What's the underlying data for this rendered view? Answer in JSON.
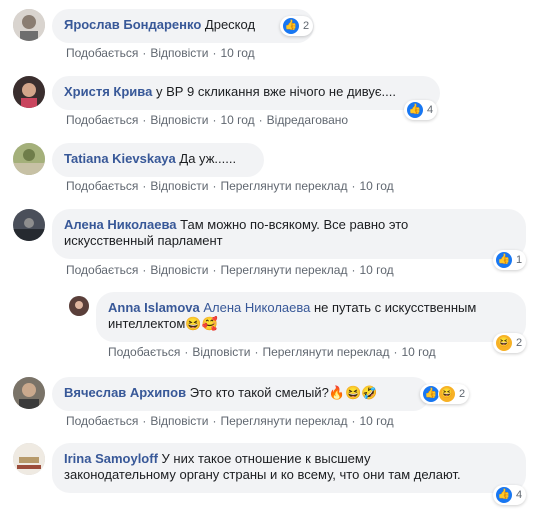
{
  "colors": {
    "author": "#385898",
    "bubble": "#f2f3f5",
    "meta": "#606770",
    "like": "#1877f2",
    "haha": "#f7b125"
  },
  "actions": {
    "like": "Подобається",
    "reply": "Відповісти",
    "translate": "Переглянути переклад",
    "edited": "Відредаговано"
  },
  "comments": [
    {
      "author": "Ярослав Бондаренко",
      "text": "Дрескод",
      "time": "10 год",
      "reactions": [
        "like-icon"
      ],
      "count": "2"
    },
    {
      "author": "Христя Крива",
      "text": "у ВР 9 скликання вже нічого не дивує....",
      "time": "10 год",
      "reactions": [
        "like-icon"
      ],
      "count": "4"
    },
    {
      "author": "Tatiana Kievskaya",
      "text": "Да уж......",
      "time": "10 год"
    },
    {
      "author": "Алена Николаева",
      "text_line1": "Там можно по-всякому. Все равно это",
      "text_line2": "искусственный парламент",
      "time": "10 год",
      "reactions": [
        "like-icon"
      ],
      "count": "1"
    },
    {
      "author": "Anna Islamova",
      "mention": "Алена Николаева",
      "text_line1": "не путать с искусственным",
      "text_line2": "интеллектом",
      "time": "10 год",
      "reactions": [
        "haha-icon"
      ],
      "count": "2"
    },
    {
      "author": "Вячеслав Архипов",
      "text": "Это кто такой смелый?",
      "time": "10 год",
      "reactions": [
        "like-icon",
        "haha-icon"
      ],
      "count": "2"
    },
    {
      "author": "Irina Samoyloff",
      "text_line1": "У них такое отношение к высшему",
      "text_line2": "законодательному органу страны и ко всему, что они там делают.",
      "time": "10 год",
      "reactions": [
        "like-icon"
      ],
      "count": "4"
    }
  ]
}
